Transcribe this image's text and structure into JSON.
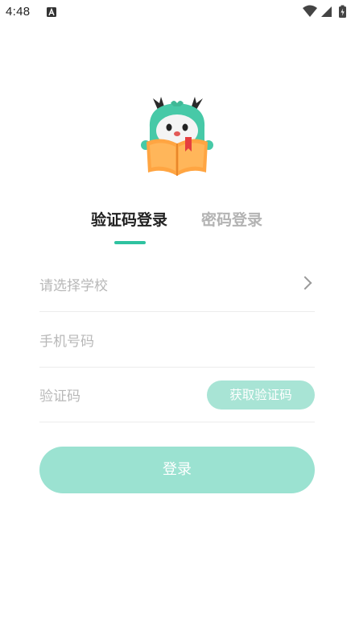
{
  "status_bar": {
    "time": "4:48",
    "icons": [
      "app-a-icon",
      "wifi-icon",
      "signal-icon",
      "battery-charging-icon"
    ]
  },
  "mascot": {
    "icon": "dragon-reading-book-mascot"
  },
  "tabs": [
    {
      "label": "验证码登录",
      "active": true
    },
    {
      "label": "密码登录",
      "active": false
    }
  ],
  "form": {
    "school_placeholder": "请选择学校",
    "phone_placeholder": "手机号码",
    "code_placeholder": "验证码",
    "get_code_label": "获取验证码"
  },
  "login_button": {
    "label": "登录"
  },
  "colors": {
    "accent": "#2ec2a0",
    "button_disabled": "#9be2d1",
    "placeholder": "#b8b8b8"
  }
}
